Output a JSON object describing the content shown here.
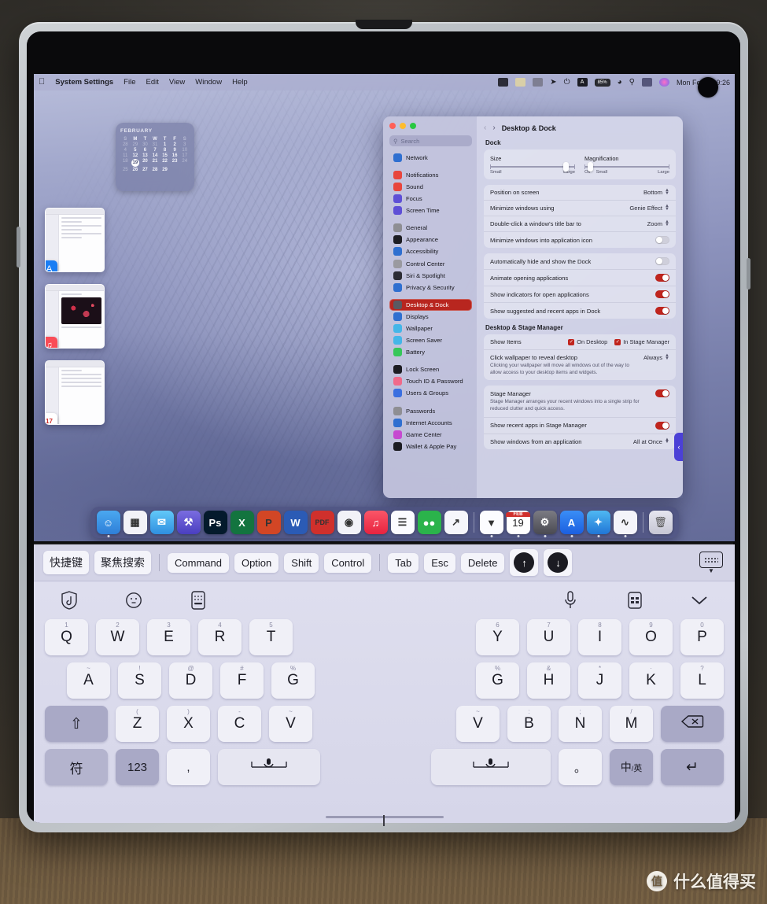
{
  "menubar": {
    "apple_icon": "apple-icon",
    "app_name": "System Settings",
    "menus": [
      "File",
      "Edit",
      "View",
      "Window",
      "Help"
    ],
    "status_icons": [
      "wechat-icon",
      "notes-icon",
      "printer-icon",
      "yandex-icon",
      "bluetooth-icon",
      "input-source-icon"
    ],
    "battery_text": "85%",
    "right_icons": [
      "wifi-icon",
      "search-icon",
      "control-center-icon",
      "siri-icon"
    ],
    "clock": "Mon Feb 19  9:26"
  },
  "calendar_widget": {
    "month": "FEBRUARY",
    "weekday_headers": [
      "S",
      "M",
      "T",
      "W",
      "T",
      "F",
      "S"
    ],
    "leading_blanks": 4,
    "days": [
      1,
      2,
      3,
      4,
      5,
      6,
      7,
      8,
      9,
      10,
      11,
      12,
      13,
      14,
      15,
      16,
      17,
      18,
      19,
      20,
      21,
      22,
      23,
      24,
      25,
      26,
      27,
      28,
      29
    ],
    "today": 19
  },
  "stage_manager": {
    "cards": [
      {
        "name": "App Store",
        "badge_icon": "appstore-icon",
        "badge_color": "#1a7ef4",
        "badge_glyph": "A"
      },
      {
        "name": "Music",
        "badge_icon": "music-icon",
        "badge_color": "#f94c57",
        "badge_glyph": "♫"
      },
      {
        "name": "Calendar",
        "badge_icon": "calendar-icon",
        "badge_color": "#ffffff",
        "badge_glyph": "17"
      }
    ]
  },
  "settings_window": {
    "titlebar": {
      "close": "close-button",
      "minimize": "minimize-button",
      "zoom": "zoom-button"
    },
    "search_placeholder": "Search",
    "sidebar_groups": [
      [
        {
          "label": "Network",
          "icon": "network-icon",
          "color": "#2f6fd0"
        }
      ],
      [
        {
          "label": "Notifications",
          "icon": "notifications-icon",
          "color": "#e8453c"
        },
        {
          "label": "Sound",
          "icon": "sound-icon",
          "color": "#e8453c"
        },
        {
          "label": "Focus",
          "icon": "focus-icon",
          "color": "#5e4fd6"
        },
        {
          "label": "Screen Time",
          "icon": "screen-time-icon",
          "color": "#5e4fd6"
        }
      ],
      [
        {
          "label": "General",
          "icon": "general-icon",
          "color": "#8e8e93"
        },
        {
          "label": "Appearance",
          "icon": "appearance-icon",
          "color": "#1c1c22"
        },
        {
          "label": "Accessibility",
          "icon": "accessibility-icon",
          "color": "#2f6fd0"
        },
        {
          "label": "Control Center",
          "icon": "control-center-icon",
          "color": "#9a9aa0"
        },
        {
          "label": "Siri & Spotlight",
          "icon": "siri-icon",
          "color": "#2c2c34"
        },
        {
          "label": "Privacy & Security",
          "icon": "privacy-icon",
          "color": "#2f6fd0"
        }
      ],
      [
        {
          "label": "Desktop & Dock",
          "icon": "desktop-dock-icon",
          "color": "#5a5a62",
          "active": true
        },
        {
          "label": "Displays",
          "icon": "displays-icon",
          "color": "#2f6fd0"
        },
        {
          "label": "Wallpaper",
          "icon": "wallpaper-icon",
          "color": "#44b6e8"
        },
        {
          "label": "Screen Saver",
          "icon": "screen-saver-icon",
          "color": "#44b6e8"
        },
        {
          "label": "Battery",
          "icon": "battery-icon",
          "color": "#35c759"
        }
      ],
      [
        {
          "label": "Lock Screen",
          "icon": "lock-screen-icon",
          "color": "#1c1c22"
        },
        {
          "label": "Touch ID & Password",
          "icon": "touch-id-icon",
          "color": "#f06a8a"
        },
        {
          "label": "Users & Groups",
          "icon": "users-groups-icon",
          "color": "#3a6fe0"
        }
      ],
      [
        {
          "label": "Passwords",
          "icon": "passwords-icon",
          "color": "#8e8e93"
        },
        {
          "label": "Internet Accounts",
          "icon": "internet-accounts-icon",
          "color": "#2f6fd0"
        },
        {
          "label": "Game Center",
          "icon": "game-center-icon",
          "color": "#c64ad0"
        },
        {
          "label": "Wallet & Apple Pay",
          "icon": "wallet-icon",
          "color": "#1c1c22"
        }
      ]
    ],
    "nav": {
      "back": "back-chevron-icon",
      "forward": "forward-chevron-icon"
    },
    "page_title": "Desktop & Dock",
    "dock_section": {
      "title": "Dock",
      "size": {
        "label": "Size",
        "min_label": "Small",
        "max_label": "Large",
        "value_pct": 86
      },
      "magnification": {
        "label": "Magnification",
        "off_label": "Off",
        "min_label": "Small",
        "max_label": "Large",
        "value_pct": 4
      },
      "rows": [
        {
          "label": "Position on screen",
          "value": "Bottom",
          "control": "popup"
        },
        {
          "label": "Minimize windows using",
          "value": "Genie Effect",
          "control": "popup"
        },
        {
          "label": "Double-click a window's title bar to",
          "value": "Zoom",
          "control": "popup"
        },
        {
          "label": "Minimize windows into application icon",
          "control": "toggle",
          "on": false
        }
      ],
      "rows2": [
        {
          "label": "Automatically hide and show the Dock",
          "control": "toggle",
          "on": false
        },
        {
          "label": "Animate opening applications",
          "control": "toggle",
          "on": true
        },
        {
          "label": "Show indicators for open applications",
          "control": "toggle",
          "on": true
        },
        {
          "label": "Show suggested and recent apps in Dock",
          "control": "toggle",
          "on": true
        }
      ]
    },
    "stage_section": {
      "title": "Desktop & Stage Manager",
      "show_items": {
        "label": "Show Items",
        "checkboxes": [
          {
            "label": "On Desktop",
            "checked": true
          },
          {
            "label": "In Stage Manager",
            "checked": true
          }
        ]
      },
      "click_wallpaper": {
        "label": "Click wallpaper to reveal desktop",
        "value": "Always",
        "description": "Clicking your wallpaper will move all windows out of the way to allow access to your desktop items and widgets."
      },
      "stage_manager": {
        "label": "Stage Manager",
        "description": "Stage Manager arranges your recent windows into a single strip for reduced clutter and quick access.",
        "on": true
      },
      "show_recent": {
        "label": "Show recent apps in Stage Manager",
        "on": true
      },
      "show_windows": {
        "label": "Show windows from an application",
        "value": "All at Once"
      }
    },
    "stage_tab_icon": "stage-manager-tab-icon"
  },
  "dock": {
    "items_left": [
      {
        "name": "Finder",
        "icon": "finder-icon",
        "glyph": "☺",
        "bg": "linear-gradient(180deg,#4aa8f0,#2f7fd8)",
        "running": true
      },
      {
        "name": "Launchpad",
        "icon": "launchpad-icon",
        "glyph": "▦",
        "bg": "#f2f2f8",
        "running": false
      },
      {
        "name": "Mail",
        "icon": "mail-icon",
        "glyph": "✉",
        "bg": "linear-gradient(180deg,#62c8f8,#2f8fe0)",
        "running": false
      },
      {
        "name": "Keynote",
        "icon": "keynote-icon",
        "glyph": "⚒",
        "bg": "linear-gradient(180deg,#7a6ce0,#4a3fc0)",
        "running": false
      },
      {
        "name": "Photoshop",
        "icon": "photoshop-icon",
        "glyph": "Ps",
        "bg": "#041a2c",
        "running": false
      },
      {
        "name": "Excel",
        "icon": "excel-icon",
        "glyph": "X",
        "bg": "#13743f",
        "running": false
      },
      {
        "name": "PowerPoint",
        "icon": "powerpoint-icon",
        "glyph": "P",
        "bg": "#d24625",
        "running": false
      },
      {
        "name": "Word",
        "icon": "word-icon",
        "glyph": "W",
        "bg": "#2b5bb5",
        "running": false
      },
      {
        "name": "PDF Reader",
        "icon": "pdf-icon",
        "glyph": "PDF",
        "bg": "#d0302c",
        "running": false
      },
      {
        "name": "Chrome",
        "icon": "chrome-icon",
        "glyph": "◉",
        "bg": "#f2f2f8",
        "running": false
      },
      {
        "name": "Music",
        "icon": "music-icon",
        "glyph": "♫",
        "bg": "linear-gradient(180deg,#fa5668,#e8233f)",
        "running": false
      },
      {
        "name": "Reminders",
        "icon": "reminders-icon",
        "glyph": "☰",
        "bg": "#fbfbff",
        "running": false
      },
      {
        "name": "WeChat",
        "icon": "wechat-icon",
        "glyph": "●●",
        "bg": "#2bb34b",
        "running": false
      },
      {
        "name": "Stocks",
        "icon": "stocks-icon",
        "glyph": "↗",
        "bg": "#f6f6fb",
        "running": false
      }
    ],
    "items_right": [
      {
        "name": "Yandex",
        "icon": "yandex-icon",
        "glyph": "▼",
        "bg": "#fcfcff",
        "running": true
      },
      {
        "name": "Calendar",
        "icon": "calendar-icon",
        "glyph": "19",
        "bg": "#ffffff",
        "running": true,
        "top_label": "FEB"
      },
      {
        "name": "Settings Gear",
        "icon": "gear-icon",
        "glyph": "⚙",
        "bg": "linear-gradient(180deg,#7b7b83,#4a4a52)",
        "running": true
      },
      {
        "name": "App Store",
        "icon": "appstore-icon",
        "glyph": "A",
        "bg": "linear-gradient(180deg,#3a8ef6,#1c5fe0)",
        "running": true
      },
      {
        "name": "Safari",
        "icon": "safari-icon",
        "glyph": "✦",
        "bg": "linear-gradient(180deg,#4fb8f2,#2176d6)",
        "running": true
      },
      {
        "name": "Activity Monitor",
        "icon": "activity-monitor-icon",
        "glyph": "∿",
        "bg": "#f4f4fa",
        "running": true
      }
    ],
    "trash": {
      "name": "Trash",
      "icon": "trash-icon",
      "glyph": "Ὕ1"
    }
  },
  "keyboard": {
    "toolbar": {
      "chips_cn": [
        "快捷键",
        "聚焦搜索"
      ],
      "modifiers": [
        "Command",
        "Option",
        "Shift",
        "Control"
      ],
      "keys": [
        "Tab",
        "Esc",
        "Delete"
      ],
      "arrow_up": "↑",
      "arrow_down": "↓",
      "hide_keyboard_icon": "hide-keyboard-icon"
    },
    "icon_row_left": [
      "handwriting-icon",
      "emoji-icon",
      "keyboard-layout-icon"
    ],
    "icon_row_right": [
      "microphone-icon",
      "split-keyboard-icon",
      "collapse-chevron-icon"
    ],
    "row1_left": [
      {
        "key": "Q",
        "sup": "1"
      },
      {
        "key": "W",
        "sup": "2"
      },
      {
        "key": "E",
        "sup": "3"
      },
      {
        "key": "R",
        "sup": "4"
      },
      {
        "key": "T",
        "sup": "5"
      }
    ],
    "row1_right": [
      {
        "key": "Y",
        "sup": "6"
      },
      {
        "key": "U",
        "sup": "7"
      },
      {
        "key": "I",
        "sup": "8"
      },
      {
        "key": "O",
        "sup": "9"
      },
      {
        "key": "P",
        "sup": "0"
      }
    ],
    "row2_left": [
      {
        "key": "A",
        "sup": "~"
      },
      {
        "key": "S",
        "sup": "!"
      },
      {
        "key": "D",
        "sup": "@"
      },
      {
        "key": "F",
        "sup": "#"
      },
      {
        "key": "G",
        "sup": "%"
      }
    ],
    "row2_right": [
      {
        "key": "G",
        "sup": "%"
      },
      {
        "key": "H",
        "sup": "&"
      },
      {
        "key": "J",
        "sup": "*"
      },
      {
        "key": "K",
        "sup": "·"
      },
      {
        "key": "L",
        "sup": "?"
      }
    ],
    "row3_left": [
      {
        "key": "⇧",
        "sup": "",
        "type": "shift"
      },
      {
        "key": "Z",
        "sup": "("
      },
      {
        "key": "X",
        "sup": ")"
      },
      {
        "key": "C",
        "sup": "-"
      },
      {
        "key": "V",
        "sup": "~"
      }
    ],
    "row3_right": [
      {
        "key": "V",
        "sup": "~"
      },
      {
        "key": "B",
        "sup": ":"
      },
      {
        "key": "N",
        "sup": ";"
      },
      {
        "key": "M",
        "sup": "/"
      },
      {
        "key": "⌫",
        "sup": "",
        "type": "backspace"
      }
    ],
    "row4_left": [
      {
        "key": "符",
        "type": "symbols"
      },
      {
        "key": "123",
        "type": "numbers"
      },
      {
        "key": ",",
        "type": "punct"
      },
      {
        "key": "Ἲ4",
        "type": "space"
      }
    ],
    "row4_right": [
      {
        "key": "Ἲ4",
        "type": "space"
      },
      {
        "key": "。",
        "type": "punct"
      },
      {
        "key": "中/英",
        "type": "lang"
      },
      {
        "key": "↵",
        "type": "return"
      }
    ]
  },
  "watermark": {
    "badge": "值",
    "text": "什么值得买"
  }
}
